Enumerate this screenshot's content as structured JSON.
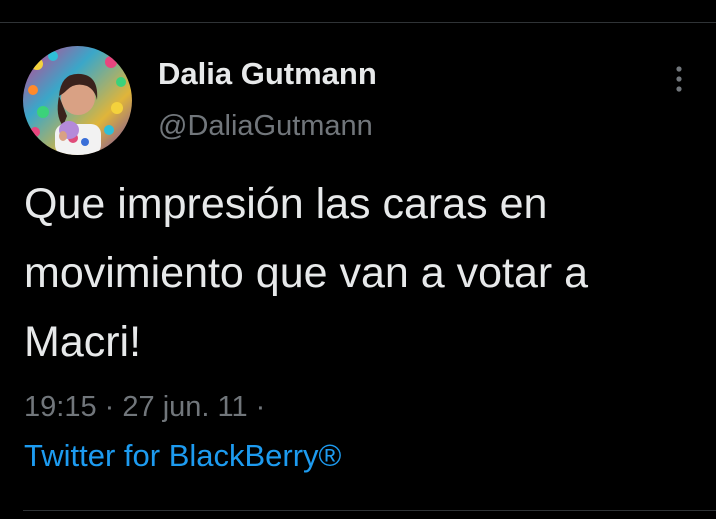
{
  "tweet": {
    "author": {
      "display_name": "Dalia Gutmann",
      "handle": "@DaliaGutmann",
      "avatar_icon": "profile-photo"
    },
    "more_icon": "more-vertical-icon",
    "text": "Que impresión las caras en movimiento que van a votar a Macri!",
    "time": "19:15",
    "separator": "·",
    "date": "27 jun. 11",
    "separator_trailing": "·",
    "source": "Twitter for BlackBerry®"
  },
  "colors": {
    "background": "#000000",
    "text_primary": "#e7e9ea",
    "text_secondary": "#71767b",
    "link": "#1d9bf0",
    "divider": "#2f3336"
  }
}
